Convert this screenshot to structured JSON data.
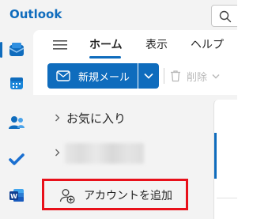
{
  "app": {
    "title": "Outlook"
  },
  "search": {
    "icon": "search-icon"
  },
  "rail": {
    "items": [
      {
        "name": "mail",
        "icon": "mail-icon",
        "active": true
      },
      {
        "name": "calendar",
        "icon": "calendar-icon"
      },
      {
        "name": "people",
        "icon": "people-icon"
      },
      {
        "name": "todo",
        "icon": "todo-icon"
      },
      {
        "name": "word",
        "icon": "word-icon"
      }
    ]
  },
  "ribbon": {
    "tabs": [
      {
        "label": "ホーム",
        "active": true
      },
      {
        "label": "表示"
      },
      {
        "label": "ヘルプ"
      }
    ],
    "new_mail_label": "新規メール",
    "delete_label": "削除"
  },
  "folders": {
    "favorites_label": "お気に入り",
    "add_account_label": "アカウントを追加"
  },
  "colors": {
    "accent": "#0f6cbd",
    "highlight_box": "#e8101a",
    "background": "#f3f3f3"
  }
}
